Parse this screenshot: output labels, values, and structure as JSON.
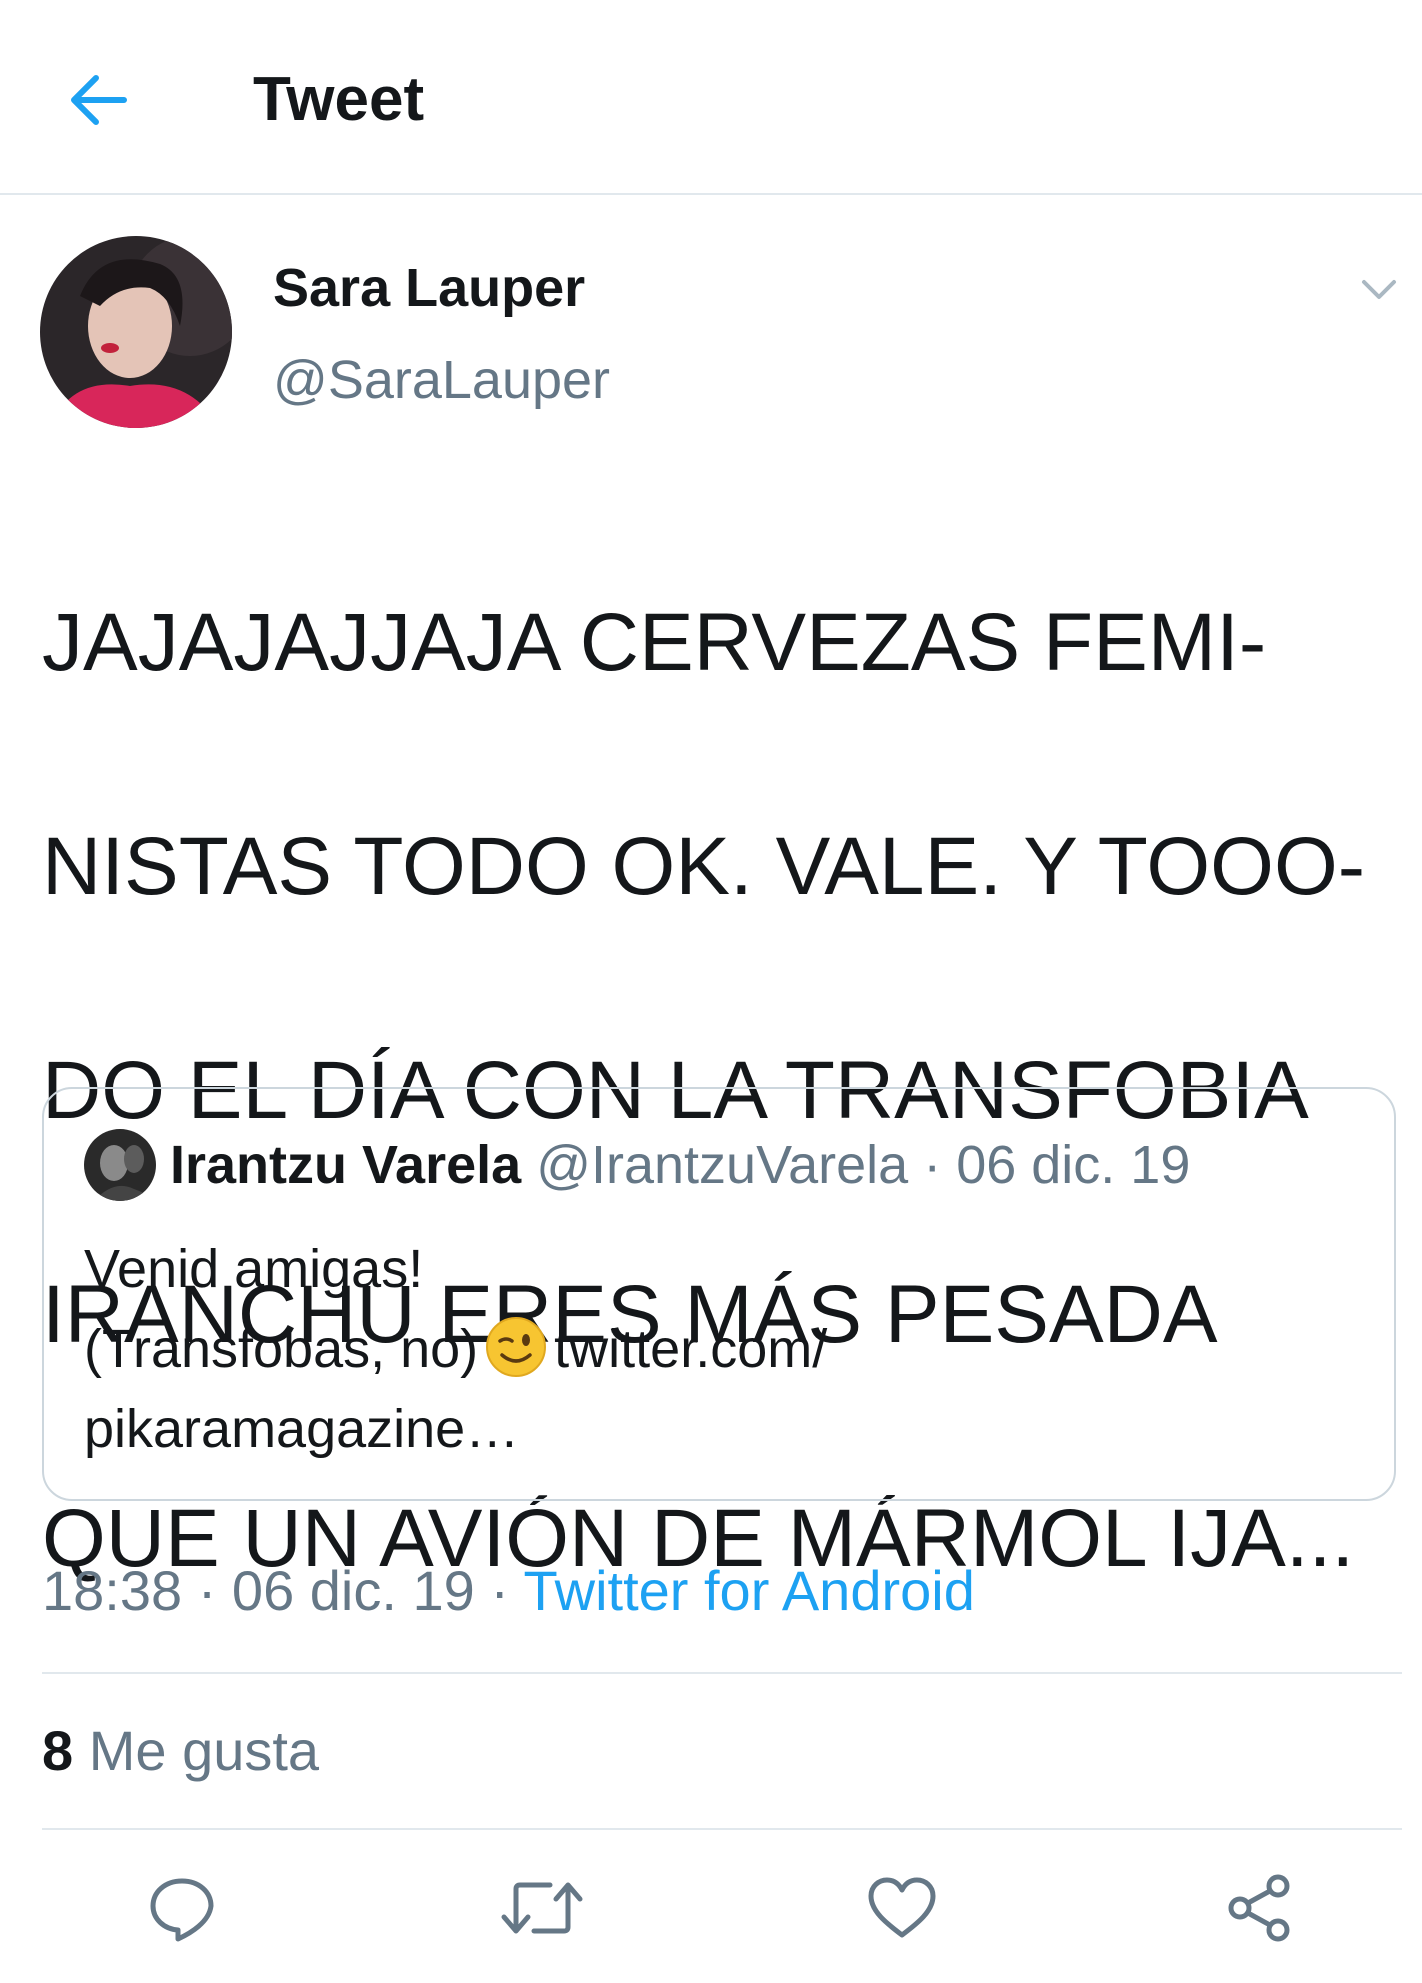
{
  "header": {
    "title": "Tweet",
    "back_icon": "arrow-left-icon"
  },
  "tweet": {
    "author_name": "Sara Lauper",
    "author_handle": "@SaraLauper",
    "text_lines": [
      "JAJAJAJJAJA CERVEZAS FEMI-",
      "NISTAS TODO OK. VALE. Y TOOO-",
      "DO EL DÍA CON LA TRANSFOBIA",
      "IRANCHU ERES MÁS PESADA",
      "QUE UN AVIÓN DE MÁRMOL IJA..."
    ],
    "time": "18:38",
    "date": "06 dic. 19",
    "separator": "·",
    "source": "Twitter for Android",
    "likes_count": "8",
    "likes_label": "Me gusta"
  },
  "quoted": {
    "name": "Irantzu Varela",
    "handle": "@IrantzuVarela",
    "separator": "·",
    "date": "06 dic. 19",
    "line1": "Venid amigas!",
    "line2_before": "(Transfobas, no)",
    "line2_after": "twitter.com/",
    "line3": "pikaramagazine…"
  },
  "colors": {
    "accent": "#1da1f2",
    "text": "#14171a",
    "secondary": "#657786",
    "border": "#e1e8ed"
  },
  "actions": [
    "reply-icon",
    "retweet-icon",
    "like-icon",
    "share-icon"
  ]
}
